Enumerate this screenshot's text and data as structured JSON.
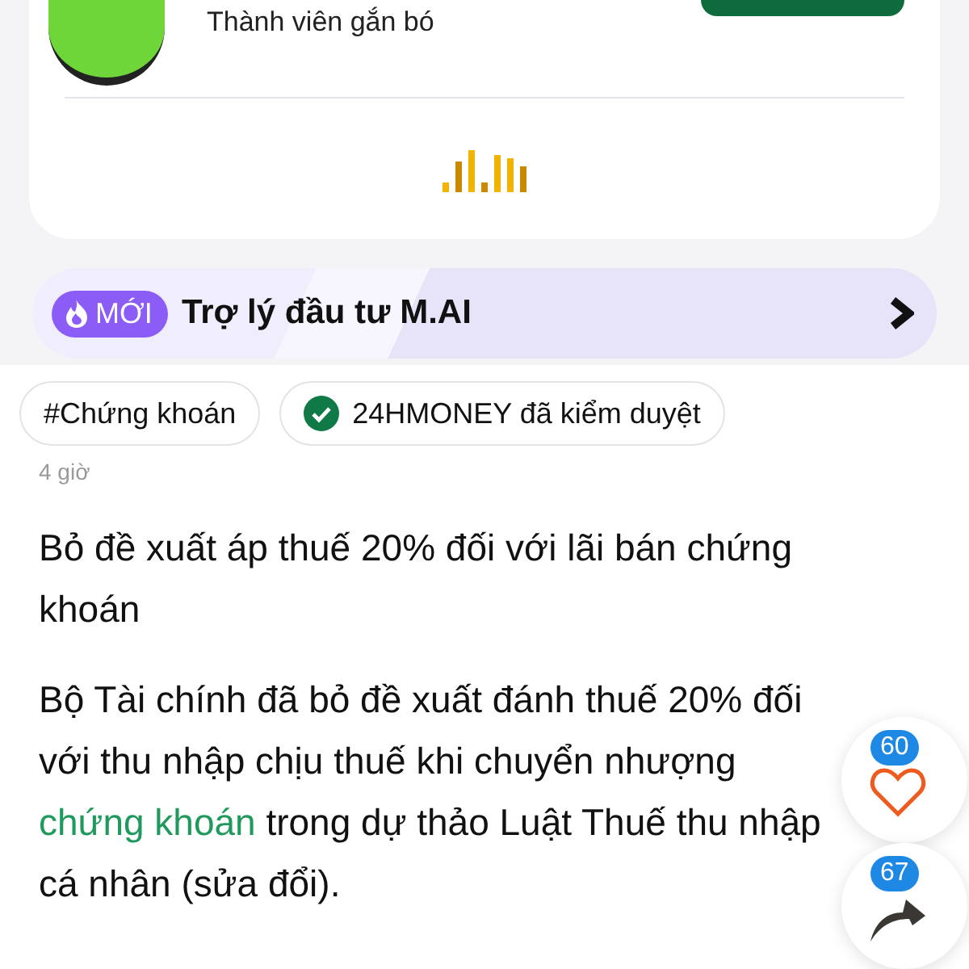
{
  "profile": {
    "subtitle": "Thành viên gắn bó"
  },
  "banner": {
    "badge": "MỚI",
    "title": "Trợ lý đầu tư M.AI"
  },
  "tags": [
    {
      "kind": "hashtag",
      "label": "#Chứng khoán"
    },
    {
      "kind": "verified",
      "label": "24HMONEY đã kiểm duyệt"
    }
  ],
  "time": "4 giờ",
  "article": {
    "title": "Bỏ đề xuất áp thuế 20% đối với lãi bán chứng khoán",
    "body_before": "Bộ Tài chính đã bỏ đề xuất đánh thuế 20% đối với thu nhập chịu thuế khi chuyển nhượng ",
    "link": "chứng khoán",
    "body_after": " trong dự thảo Luật Thuế thu nhập cá nhân (sửa đổi)."
  },
  "actions": [
    {
      "kind": "like",
      "count": "60"
    },
    {
      "kind": "share",
      "count": "67"
    }
  ]
}
